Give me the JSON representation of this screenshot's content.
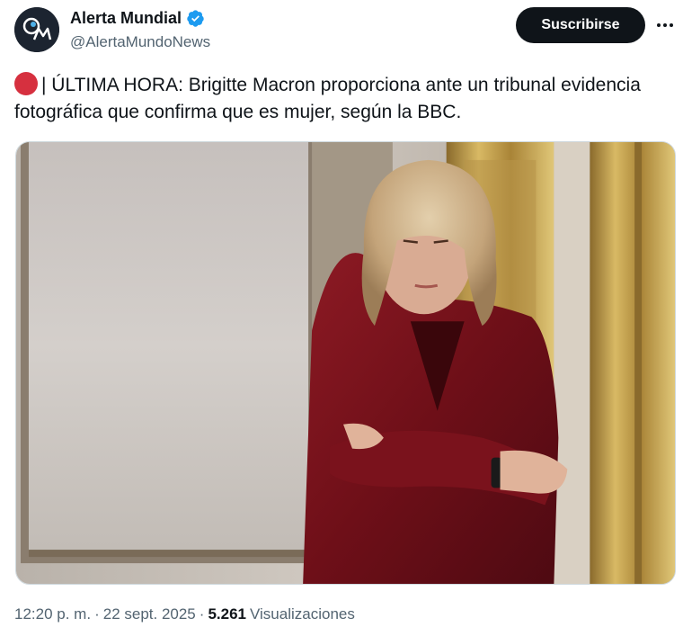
{
  "author": {
    "display_name": "Alerta Mundial",
    "handle": "@AlertaMundoNews",
    "verified": true,
    "avatar_icon": "am-logo-icon"
  },
  "actions": {
    "subscribe_label": "Suscribirse",
    "more_icon": "more-dots-icon"
  },
  "tweet": {
    "emoji_color": "#d6303f",
    "text": "| ÚLTIMA HORA: Brigitte Macron proporciona ante un tribunal evidencia fotográfica que confirma que es mujer, según la BBC."
  },
  "meta": {
    "time": "12:20 p. m.",
    "separator": "·",
    "date": "22 sept. 2025",
    "views_count": "5.261",
    "views_label": "Visualizaciones"
  },
  "colors": {
    "text_primary": "#0f1419",
    "text_secondary": "#536471",
    "verified_blue": "#1d9bf0",
    "button_bg": "#0f1419"
  }
}
